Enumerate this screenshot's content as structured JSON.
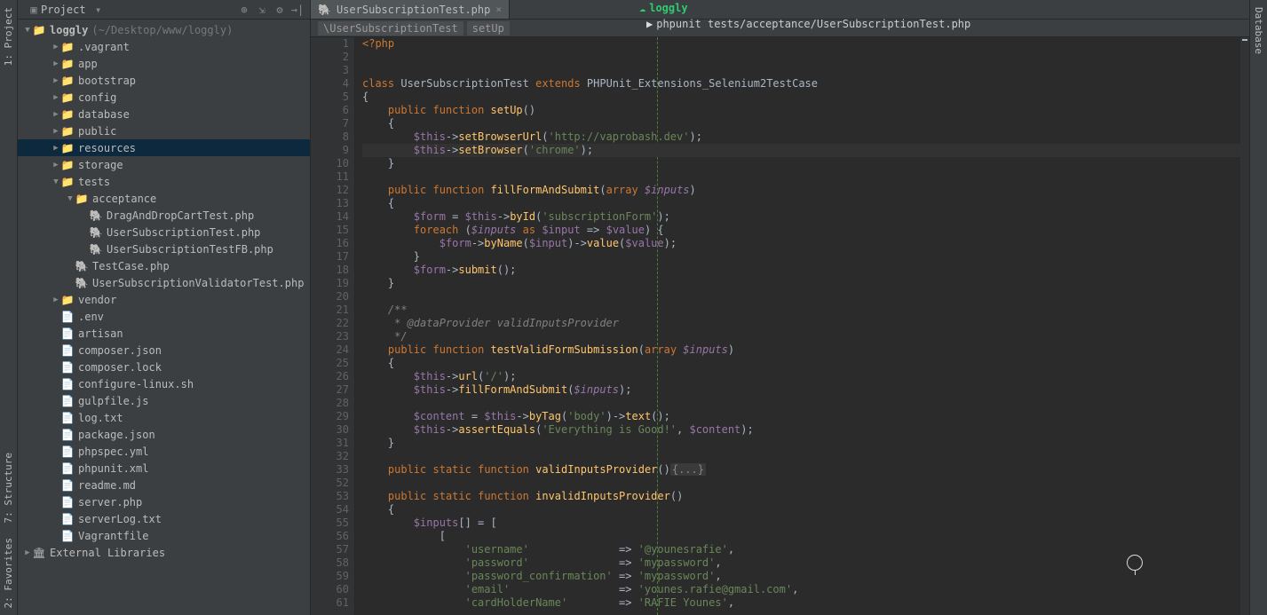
{
  "leftRail": {
    "project": "1: Project",
    "structure": "7: Structure",
    "favorites": "2: Favorites"
  },
  "sidebar": {
    "title": "Project",
    "root": {
      "name": "loggly",
      "path": "(~/Desktop/www/loggly)"
    },
    "items": [
      {
        "indent": 2,
        "arrow": "▶",
        "icon": "📁",
        "name": ".vagrant"
      },
      {
        "indent": 2,
        "arrow": "▶",
        "icon": "📁",
        "name": "app"
      },
      {
        "indent": 2,
        "arrow": "▶",
        "icon": "📁",
        "name": "bootstrap"
      },
      {
        "indent": 2,
        "arrow": "▶",
        "icon": "📁",
        "name": "config"
      },
      {
        "indent": 2,
        "arrow": "▶",
        "icon": "📁",
        "name": "database"
      },
      {
        "indent": 2,
        "arrow": "▶",
        "icon": "📁",
        "name": "public"
      },
      {
        "indent": 2,
        "arrow": "▶",
        "icon": "📁",
        "name": "resources",
        "selected": true
      },
      {
        "indent": 2,
        "arrow": "▶",
        "icon": "📁",
        "name": "storage"
      },
      {
        "indent": 2,
        "arrow": "▼",
        "icon": "📁",
        "name": "tests"
      },
      {
        "indent": 3,
        "arrow": "▼",
        "icon": "📁",
        "name": "acceptance"
      },
      {
        "indent": 4,
        "arrow": "",
        "icon": "🐘",
        "name": "DragAndDropCartTest.php"
      },
      {
        "indent": 4,
        "arrow": "",
        "icon": "🐘",
        "name": "UserSubscriptionTest.php"
      },
      {
        "indent": 4,
        "arrow": "",
        "icon": "🐘",
        "name": "UserSubscriptionTestFB.php"
      },
      {
        "indent": 3,
        "arrow": "",
        "icon": "🐘",
        "name": "TestCase.php"
      },
      {
        "indent": 3,
        "arrow": "",
        "icon": "🐘",
        "name": "UserSubscriptionValidatorTest.php"
      },
      {
        "indent": 2,
        "arrow": "▶",
        "icon": "📁",
        "name": "vendor"
      },
      {
        "indent": 2,
        "arrow": "",
        "icon": "📄",
        "name": ".env"
      },
      {
        "indent": 2,
        "arrow": "",
        "icon": "📄",
        "name": "artisan"
      },
      {
        "indent": 2,
        "arrow": "",
        "icon": "📄",
        "name": "composer.json"
      },
      {
        "indent": 2,
        "arrow": "",
        "icon": "📄",
        "name": "composer.lock"
      },
      {
        "indent": 2,
        "arrow": "",
        "icon": "📄",
        "name": "configure-linux.sh"
      },
      {
        "indent": 2,
        "arrow": "",
        "icon": "📄",
        "name": "gulpfile.js"
      },
      {
        "indent": 2,
        "arrow": "",
        "icon": "📄",
        "name": "log.txt"
      },
      {
        "indent": 2,
        "arrow": "",
        "icon": "📄",
        "name": "package.json"
      },
      {
        "indent": 2,
        "arrow": "",
        "icon": "📄",
        "name": "phpspec.yml"
      },
      {
        "indent": 2,
        "arrow": "",
        "icon": "📄",
        "name": "phpunit.xml"
      },
      {
        "indent": 2,
        "arrow": "",
        "icon": "📄",
        "name": "readme.md"
      },
      {
        "indent": 2,
        "arrow": "",
        "icon": "📄",
        "name": "server.php"
      },
      {
        "indent": 2,
        "arrow": "",
        "icon": "📄",
        "name": "serverLog.txt"
      },
      {
        "indent": 2,
        "arrow": "",
        "icon": "📄",
        "name": "Vagrantfile"
      }
    ],
    "external": "External Libraries"
  },
  "tab": {
    "name": "UserSubscriptionTest.php"
  },
  "breadcrumb": {
    "a": "\\UserSubscriptionTest",
    "b": "setUp"
  },
  "terminal": {
    "prompt": "loggly",
    "cmd": "phpunit tests/acceptance/UserSubscriptionTest.php"
  },
  "rightRail": {
    "db": "Database"
  },
  "gutterLines": [
    "1",
    "2",
    "3",
    "4",
    "5",
    "6",
    "7",
    "8",
    "9",
    "10",
    "11",
    "12",
    "13",
    "14",
    "15",
    "16",
    "17",
    "18",
    "19",
    "20",
    "21",
    "22",
    "23",
    "24",
    "25",
    "26",
    "27",
    "28",
    "29",
    "30",
    "31",
    "32",
    "33",
    "52",
    "53",
    "54",
    "55",
    "56",
    "57",
    "58",
    "59",
    "60",
    "61"
  ]
}
